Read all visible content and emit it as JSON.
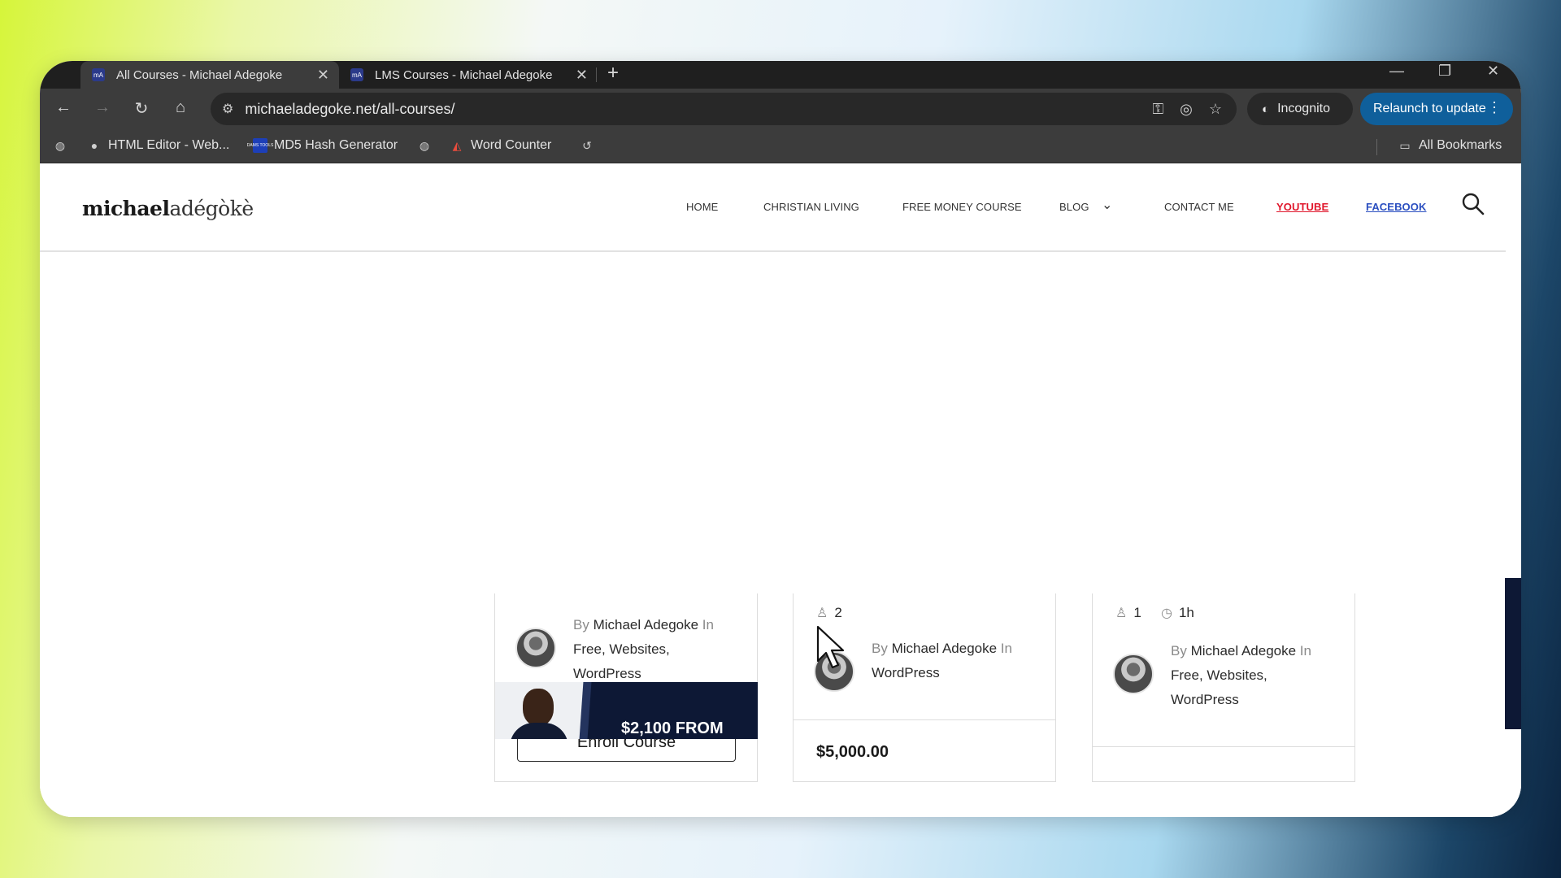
{
  "browser": {
    "tabs": [
      {
        "title": "All Courses - Michael Adegoke",
        "favicon": "mA"
      },
      {
        "title": "LMS Courses - Michael Adegoke",
        "favicon": "mA"
      }
    ],
    "url": "michaeladegoke.net/all-courses/",
    "incognito_label": "Incognito",
    "relaunch_label": "Relaunch to update",
    "bookmarks": [
      {
        "label": "HTML Editor - Web..."
      },
      {
        "label": "MD5 Hash Generator"
      },
      {
        "label": "Word Counter"
      }
    ],
    "all_bookmarks_label": "All Bookmarks",
    "md5_icon_text": "DAMS TOOLS"
  },
  "site": {
    "logo_bold": "michael",
    "logo_light": "adégòkè",
    "nav": {
      "home": "HOME",
      "christian_living": "CHRISTIAN LIVING",
      "free_money_course": "FREE MONEY COURSE",
      "blog": "BLOG",
      "contact": "CONTACT ME",
      "youtube": "YOUTUBE",
      "facebook": "FACEBOOK"
    },
    "accent_youtube": "#e0162b",
    "accent_facebook": "#2b4fc0"
  },
  "cards": [
    {
      "by": "By",
      "author": "Michael Adegoke",
      "in": "In",
      "categories": [
        "Free",
        "Websites",
        "WordPress"
      ],
      "button": "Enroll Course"
    },
    {
      "students": "2",
      "by": "By",
      "author": "Michael Adegoke",
      "in": "In",
      "categories": [
        "WordPress"
      ],
      "price": "$5,000.00"
    },
    {
      "students": "1",
      "duration": "1h",
      "by": "By",
      "author": "Michael Adegoke",
      "in": "In",
      "categories": [
        "Free",
        "Websites",
        "WordPress"
      ]
    }
  ],
  "promo": {
    "text": "$2,100 FROM"
  }
}
